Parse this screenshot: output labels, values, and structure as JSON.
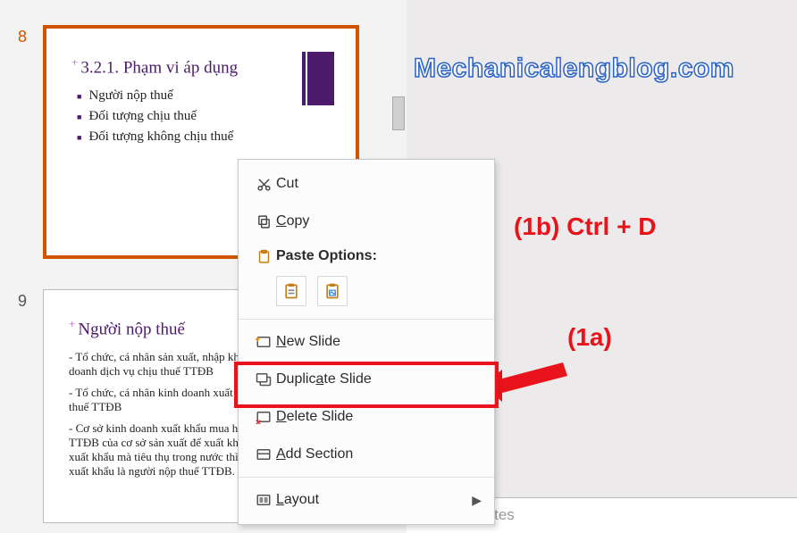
{
  "watermark": "Mechanicalengblog.com",
  "annotations": {
    "shortcut": "(1b) Ctrl + D",
    "callout": "(1a)"
  },
  "slides": {
    "s8": {
      "number": "8",
      "title": "3.2.1. Phạm vi áp dụng",
      "bullets": [
        "Người nộp thuế",
        "Đối tượng chịu thuế",
        "Đối tượng không chịu thuế"
      ]
    },
    "s9": {
      "number": "9",
      "title": "Người nộp thuế",
      "paras": [
        "- Tổ chức, cá nhân sản xuất, nhập khẩu hàng hóa và kinh doanh dịch vụ chịu thuế TTĐB",
        "- Tổ chức, cá nhân kinh doanh xuất khẩu mua hàng chịu thuế TTĐB",
        "- Cơ sở kinh doanh xuất khẩu mua hàng chịu thuế TTĐB của cơ sở sản xuất để xuất khẩu nhưng không xuất khẩu mà tiêu thụ trong nước thì cơ sở kinh doanh xuất khẩu là người nộp thuế TTĐB."
      ]
    }
  },
  "context_menu": {
    "cut": "Cut",
    "copy": "Copy",
    "paste_header": "Paste Options:",
    "new_slide": "New Slide",
    "duplicate": "Duplicate Slide",
    "delete": "Delete Slide",
    "add_section": "Add Section",
    "layout": "Layout"
  },
  "notes_placeholder": "k to add notes",
  "icons": {
    "cut": "cut",
    "copy": "copy",
    "paste": "paste",
    "paste_text": "paste-text",
    "paste_image": "paste-image",
    "new_slide": "new-slide",
    "duplicate": "duplicate",
    "delete": "delete-slide",
    "section": "section",
    "layout": "layout"
  }
}
